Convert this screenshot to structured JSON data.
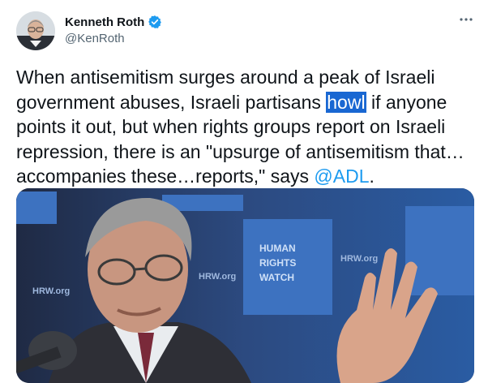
{
  "author": {
    "name": "Kenneth Roth",
    "handle": "@KenRoth",
    "verified_icon": "verified-badge-icon"
  },
  "more_icon": "more-options-icon",
  "tweet": {
    "text_before": "When antisemitism surges around a peak of Israeli government abuses, Israeli partisans ",
    "highlighted": "howl",
    "text_middle": " if anyone points it out, but when rights groups report on Israeli repression, there is an \"upsurge of antisemitism that…accompanies these…reports,\" says ",
    "mention": "@ADL",
    "text_after": "."
  },
  "media": {
    "backdrop_logo_lines": [
      "HUMAN",
      "RIGHTS",
      "WATCH"
    ],
    "backdrop_url": "HRW.org"
  },
  "colors": {
    "link": "#1d9bf0",
    "verified": "#1d9bf0",
    "selection": "#1967d2",
    "backdrop": "#2b5b9e"
  }
}
